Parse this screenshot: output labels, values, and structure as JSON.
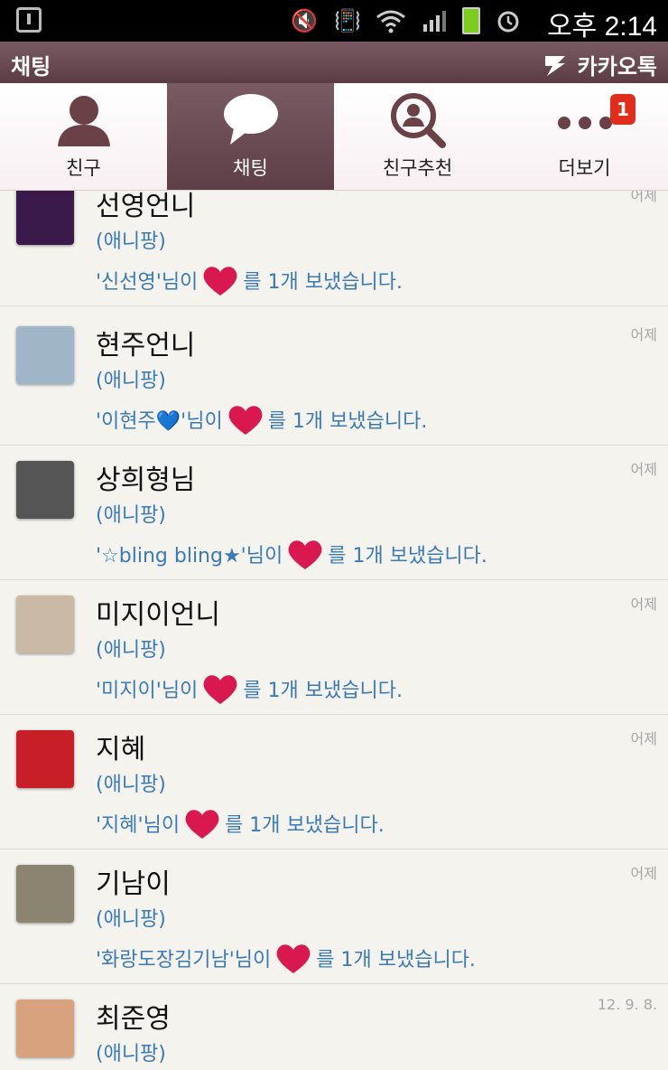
{
  "status_bar": {
    "time": "오후 2:14",
    "battery_color": "#7ccd1d"
  },
  "titlebar": {
    "title": "채팅",
    "brand": "카카오톡"
  },
  "tabs": [
    {
      "label": "친구",
      "icon": "person-icon",
      "active": false
    },
    {
      "label": "채팅",
      "icon": "speech-bubble-icon",
      "active": true
    },
    {
      "label": "친구추천",
      "icon": "search-person-icon",
      "active": false
    },
    {
      "label": "더보기",
      "icon": "more-dots-icon",
      "active": false,
      "badge": "1"
    }
  ],
  "chats": [
    {
      "name": "선영언니",
      "game": "(애니팡)",
      "msg_prefix": "'신선영'님이",
      "msg_suffix": "를 1개 보냈습니다.",
      "time": "어제",
      "avatar_color": "#3a1a4a"
    },
    {
      "name": "현주언니",
      "game": "(애니팡)",
      "msg_prefix": "'이현주💙'님이",
      "msg_suffix": "를 1개 보냈습니다.",
      "time": "어제",
      "avatar_color": "#9fb5c8"
    },
    {
      "name": "상희형님",
      "game": "(애니팡)",
      "msg_prefix": "'☆bling  bling★'님이",
      "msg_suffix": "를 1개 보냈습니다.",
      "time": "어제",
      "avatar_color": "#555555"
    },
    {
      "name": "미지이언니",
      "game": "(애니팡)",
      "msg_prefix": "'미지이'님이",
      "msg_suffix": "를 1개 보냈습니다.",
      "time": "어제",
      "avatar_color": "#c9b9a5"
    },
    {
      "name": "지혜",
      "game": "(애니팡)",
      "msg_prefix": "'지혜'님이",
      "msg_suffix": "를 1개 보냈습니다.",
      "time": "어제",
      "avatar_color": "#c81e28"
    },
    {
      "name": "기남이",
      "game": "(애니팡)",
      "msg_prefix": "'화랑도장김기남'님이",
      "msg_suffix": "를 1개 보냈습니다.",
      "time": "어제",
      "avatar_color": "#8a8470"
    },
    {
      "name": "최준영",
      "game": "(애니팡)",
      "msg_prefix": "",
      "msg_suffix": "",
      "time": "12. 9. 8.",
      "avatar_color": "#d9a27f"
    }
  ]
}
